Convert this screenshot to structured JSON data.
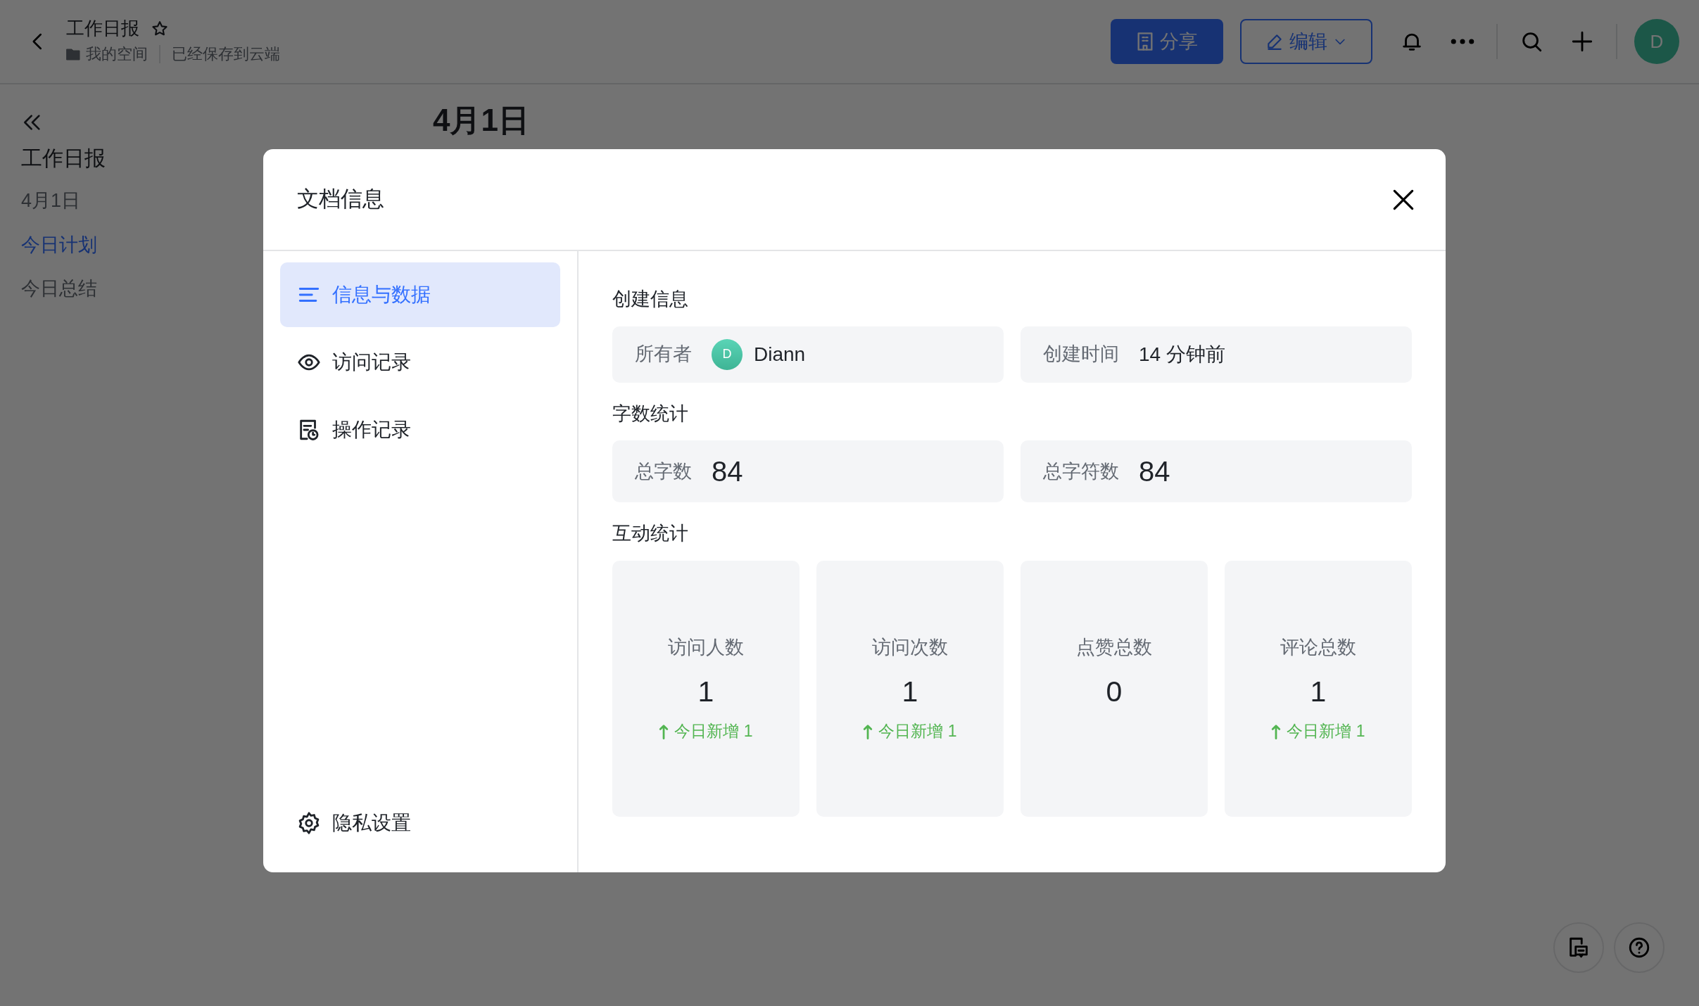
{
  "header": {
    "title": "工作日报",
    "breadcrumb": "我的空间",
    "save_status": "已经保存到云端",
    "share_button": "分享",
    "edit_button": "编辑",
    "avatar": "D"
  },
  "outline": {
    "items": [
      {
        "label": "工作日报",
        "kind": "heading",
        "selected": false
      },
      {
        "label": "4月1日",
        "kind": "item",
        "selected": false
      },
      {
        "label": "今日计划",
        "kind": "item",
        "selected": true
      },
      {
        "label": "今日总结",
        "kind": "item",
        "selected": false
      }
    ]
  },
  "document": {
    "title": "4月1日"
  },
  "dialog": {
    "title": "文档信息",
    "nav": [
      {
        "label": "信息与数据",
        "selected": true
      },
      {
        "label": "访问记录",
        "selected": false
      },
      {
        "label": "操作记录",
        "selected": false
      }
    ],
    "settings_item": "隐私设置",
    "creation": {
      "heading": "创建信息",
      "owner_label": "所有者",
      "owner_avatar": "D",
      "owner_name": "Diann",
      "created_label": "创建时间",
      "created_value": "14 分钟前"
    },
    "word_stats": {
      "heading": "字数统计",
      "items": [
        {
          "label": "总字数",
          "value": "84"
        },
        {
          "label": "总字符数",
          "value": "84"
        }
      ]
    },
    "interaction": {
      "heading": "互动统计",
      "cards": [
        {
          "label": "访问人数",
          "value": "1",
          "delta": "今日新增 1"
        },
        {
          "label": "访问次数",
          "value": "1",
          "delta": "今日新增 1"
        },
        {
          "label": "点赞总数",
          "value": "0"
        },
        {
          "label": "评论总数",
          "value": "1",
          "delta": "今日新增 1"
        }
      ]
    }
  }
}
